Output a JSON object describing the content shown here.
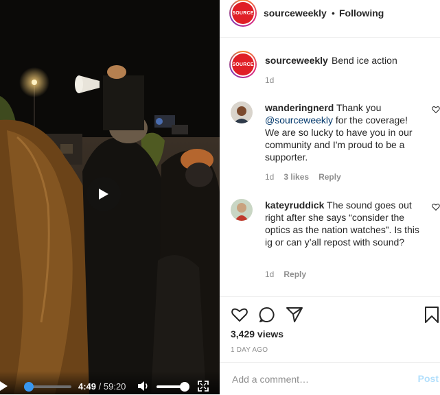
{
  "video": {
    "current_time": "4:49",
    "separator": " / ",
    "total_time": "59:20",
    "progress_fraction": 0.081,
    "volume_fraction": 1.0,
    "accent_color": "#3897f0"
  },
  "post": {
    "username": "sourceweekly",
    "follow_separator": "•",
    "follow_status": "Following",
    "logo_text": "SOURCE",
    "caption": "Bend ice action",
    "caption_age": "1d"
  },
  "comments": [
    {
      "username": "wanderingnerd",
      "text_before": " Thank you ",
      "mention": "@sourceweekly",
      "text_after": " for the coverage! We are so lucky to have you in our community and I'm proud to be a supporter.",
      "age": "1d",
      "likes": "3 likes",
      "reply_label": "Reply"
    },
    {
      "username": "kateyruddick",
      "text": " The sound goes out right after she says “consider the optics as the nation watches”. Is this ig or can y’all repost with sound?",
      "age": "1d",
      "reply_label": "Reply"
    }
  ],
  "stats": {
    "views": "3,429 views",
    "posted": "1 DAY AGO"
  },
  "composer": {
    "placeholder": "Add a comment…",
    "post_label": "Post"
  },
  "icons": {
    "like": "heart-icon",
    "comment": "comment-bubble-icon",
    "share": "paper-plane-icon",
    "save": "bookmark-icon",
    "play": "play-icon",
    "volume": "volume-icon",
    "fullscreen": "fullscreen-icon"
  }
}
